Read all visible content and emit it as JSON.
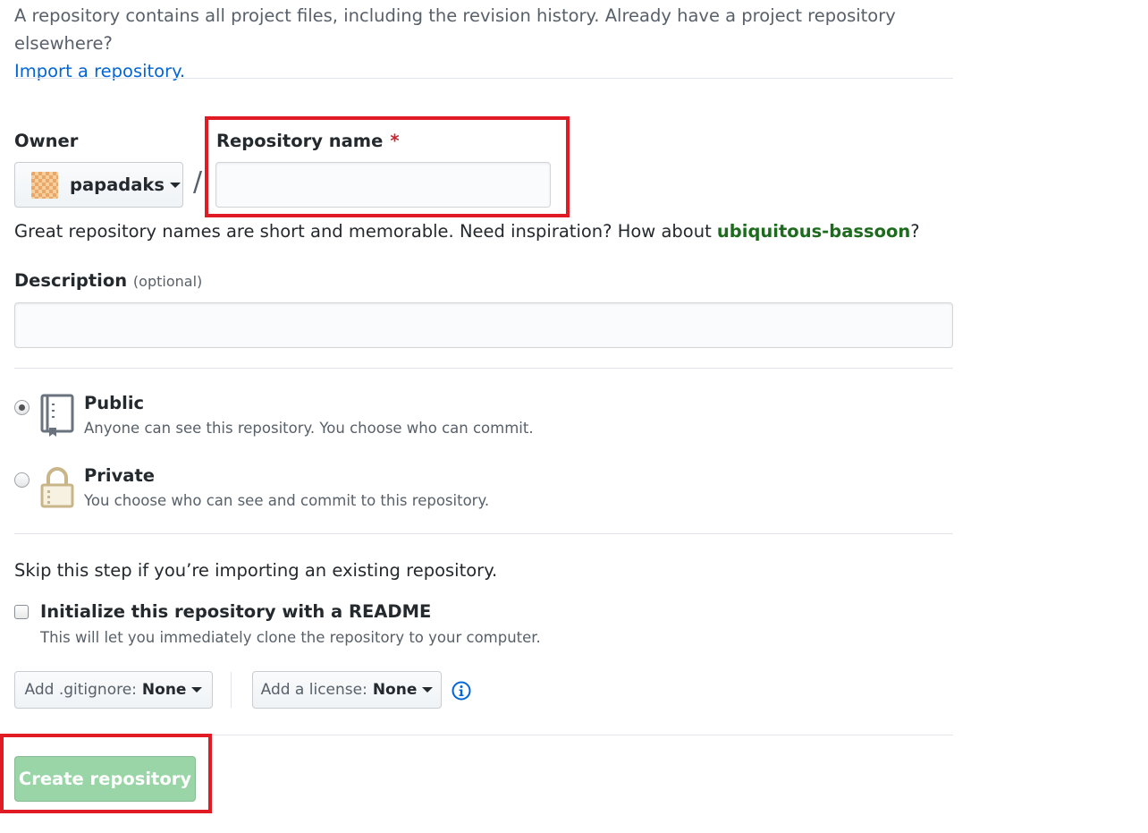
{
  "intro": {
    "text": "A repository contains all project files, including the revision history. Already have a project repository elsewhere?",
    "import_link": "Import a repository."
  },
  "owner": {
    "label": "Owner",
    "name": "papadaks"
  },
  "separator_char": "/",
  "repo_name": {
    "label": "Repository name",
    "required_mark": "*",
    "value": "",
    "placeholder": ""
  },
  "name_hint": {
    "prefix": "Great repository names are short and memorable. Need inspiration? How about ",
    "suggestion": "ubiquitous-bassoon",
    "suffix": "?"
  },
  "description": {
    "label": "Description",
    "optional": "(optional)",
    "value": "",
    "placeholder": ""
  },
  "visibility": {
    "selected": "public",
    "public": {
      "title": "Public",
      "desc": "Anyone can see this repository. You choose who can commit.",
      "icon": "repo-book-icon"
    },
    "private": {
      "title": "Private",
      "desc": "You choose who can see and commit to this repository.",
      "icon": "lock-icon"
    }
  },
  "init": {
    "skip_text": "Skip this step if you’re importing an existing repository.",
    "readme_label": "Initialize this repository with a README",
    "readme_desc": "This will let you immediately clone the repository to your computer.",
    "readme_checked": false
  },
  "gitignore": {
    "label": "Add .gitignore:",
    "value": "None"
  },
  "license": {
    "label": "Add a license:",
    "value": "None"
  },
  "info_icon": "info-icon",
  "create_button": "Create repository",
  "colors": {
    "link": "#0366d6",
    "suggestion": "#1d6b1d",
    "required": "#cb2431",
    "create_disabled": "#94d3a2",
    "highlight": "#e01b24"
  }
}
